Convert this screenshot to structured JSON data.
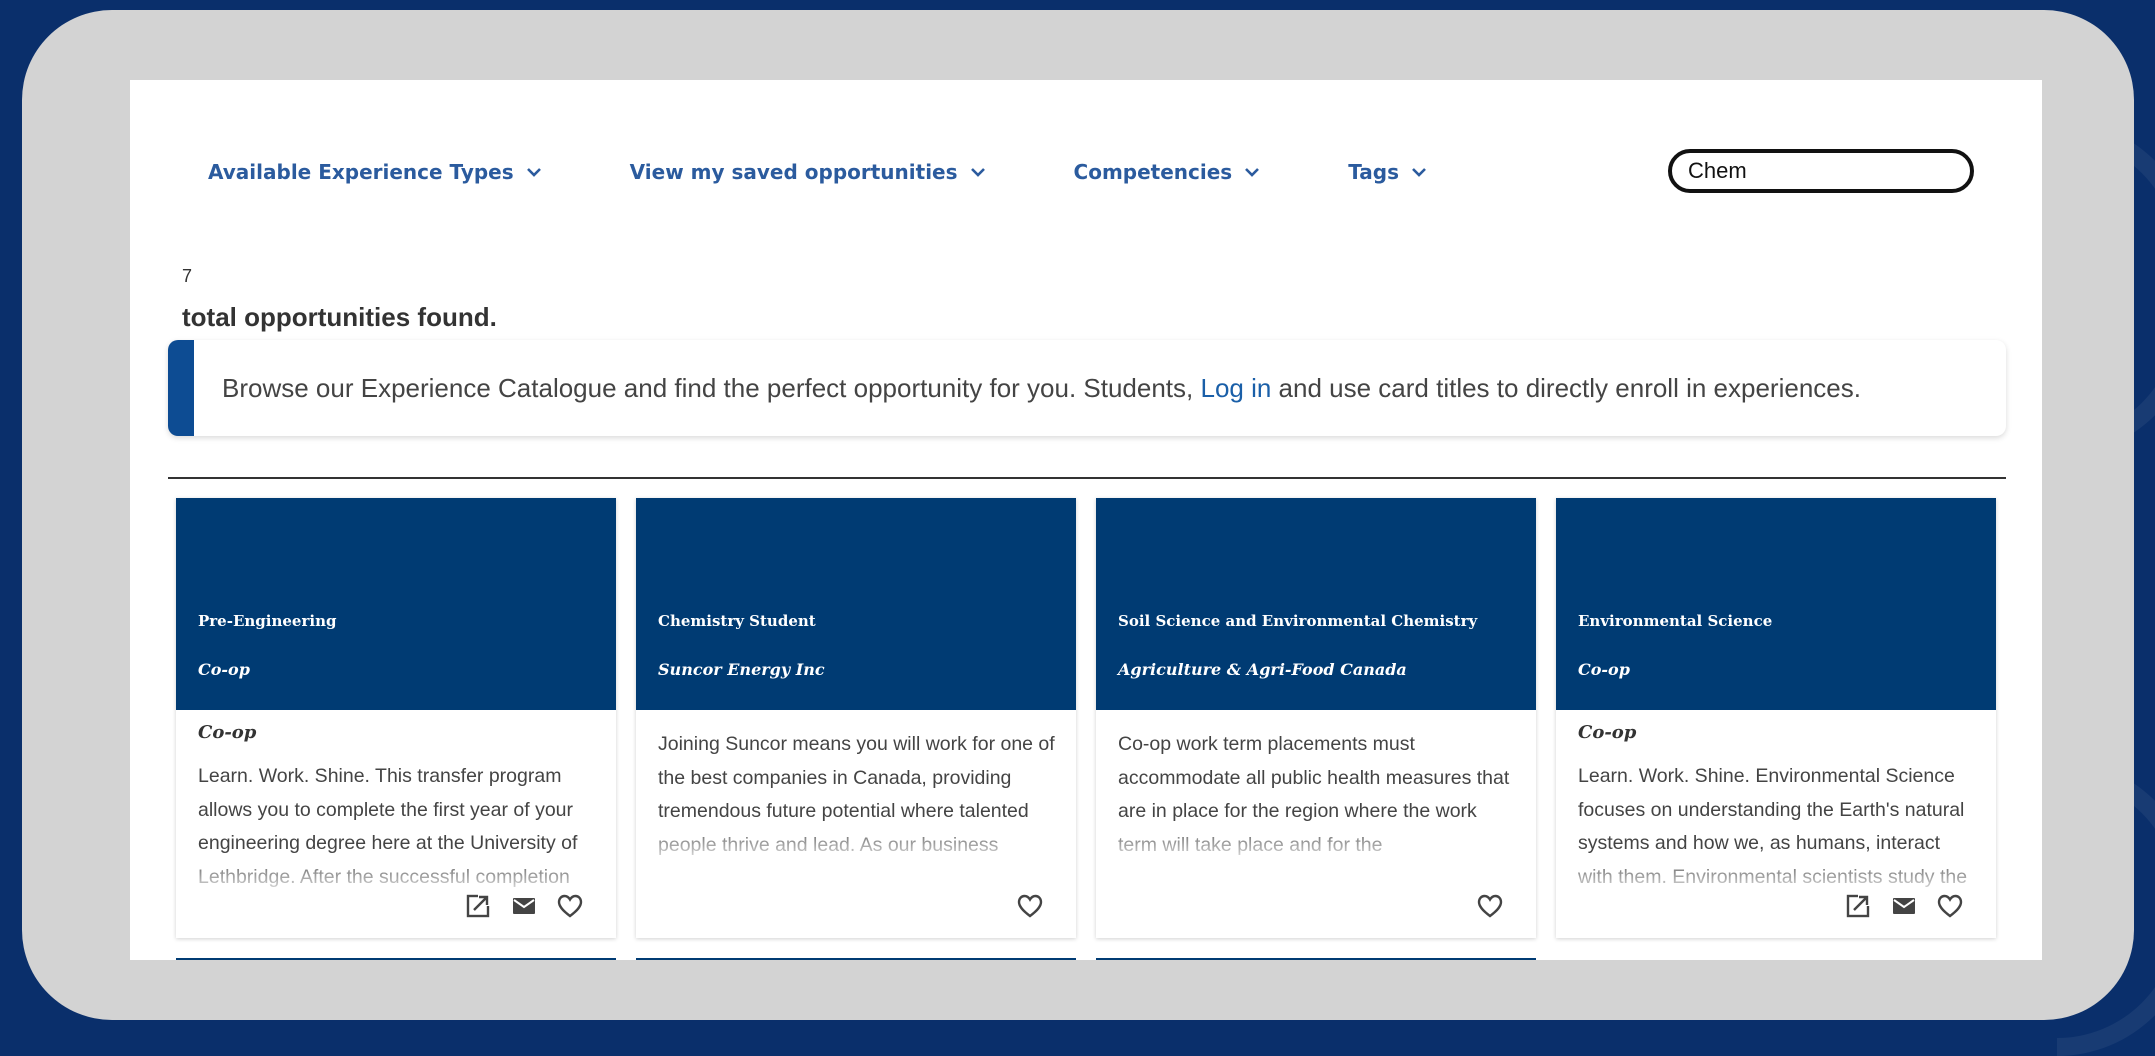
{
  "nav": [
    {
      "label": "Available Experience Types"
    },
    {
      "label": "View my saved opportunities"
    },
    {
      "label": "Competencies"
    },
    {
      "label": "Tags"
    }
  ],
  "search": {
    "value": "Chem"
  },
  "results": {
    "count": "7",
    "label": "total opportunities found."
  },
  "notice": {
    "before": "Browse our Experience Catalogue and find the perfect opportunity for you. Students, ",
    "link": "Log in",
    "after": " and use card titles to directly enroll in experiences."
  },
  "cards": [
    {
      "title": "Pre-Engineering",
      "subtitle": "Co-op",
      "kind": "Co-op",
      "description": "Learn. Work. Shine. This transfer program allows you to complete the first year of your engineering degree here at the University of Lethbridge. After the successful completion"
    },
    {
      "title": "Chemistry Student",
      "subtitle": "Suncor Energy Inc",
      "kind": "",
      "description": "Joining Suncor means you will work for one of the best companies in Canada, providing tremendous future potential where talented people thrive and lead. As our business"
    },
    {
      "title": "Soil Science and Environmental Chemistry",
      "subtitle": "Agriculture & Agri-Food Canada",
      "kind": "",
      "description": "Co-op work term placements must accommodate all public health measures that are in place for the region where the work term will take place and for the"
    },
    {
      "title": "Environmental Science",
      "subtitle": "Co-op",
      "kind": "Co-op",
      "description": "Learn. Work. Shine. Environmental Science focuses on understanding the Earth's natural systems and how we, as humans, interact with them. Environmental scientists study the"
    }
  ],
  "colors": {
    "background": "#0a2f6b",
    "card_header": "#003b73",
    "nav_link": "#2b5b9e",
    "accent": "#0d4c93"
  },
  "icons": [
    "chevron-down-icon",
    "external-link-icon",
    "mail-icon",
    "heart-icon"
  ]
}
